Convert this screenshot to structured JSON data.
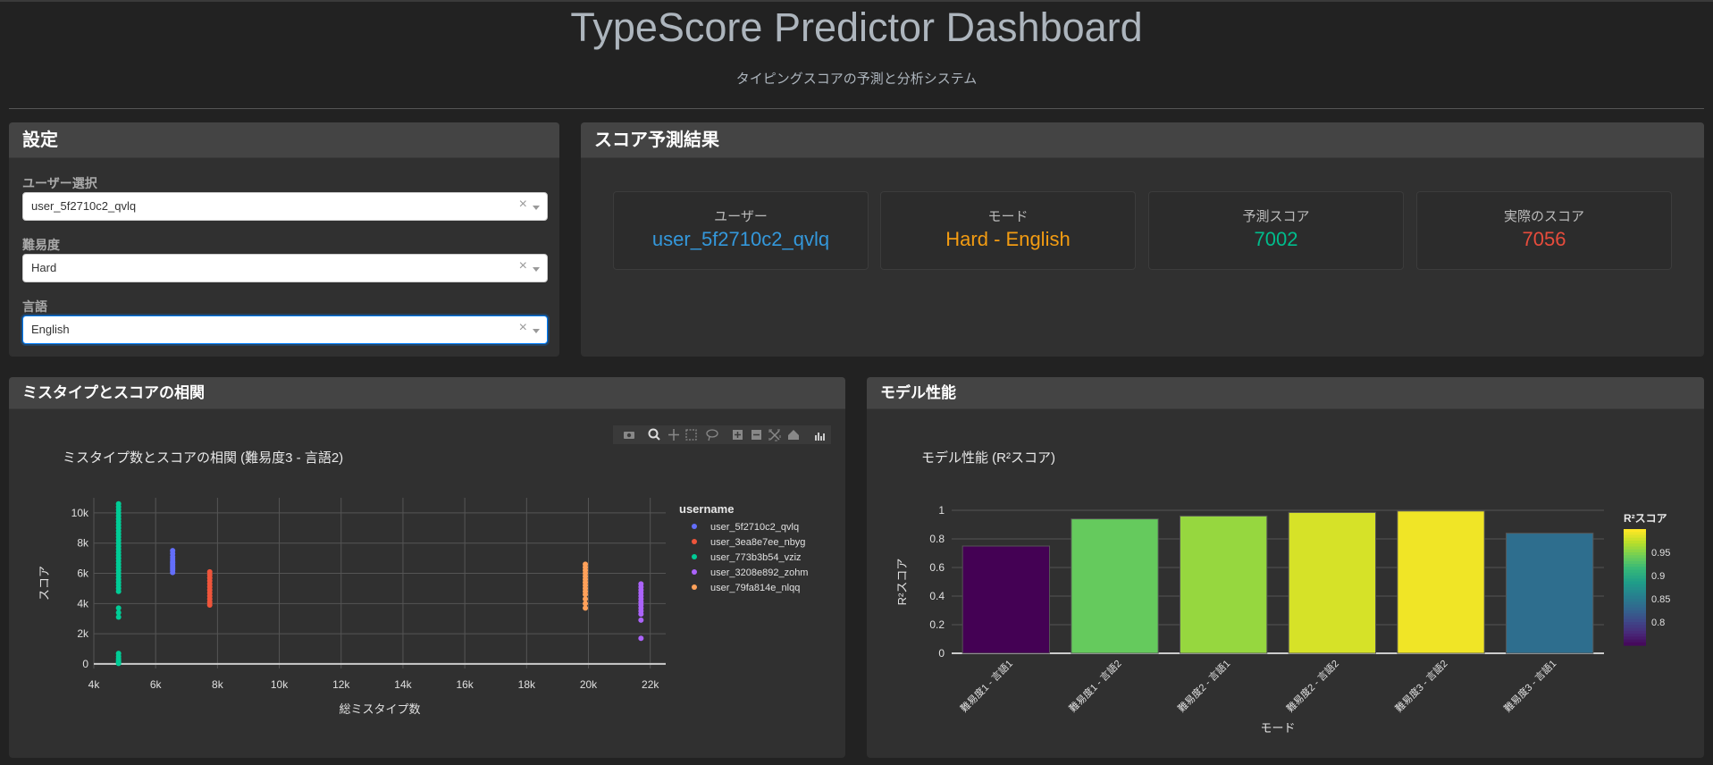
{
  "header": {
    "title": "TypeScore Predictor Dashboard",
    "subtitle": "タイピングスコアの予測と分析システム"
  },
  "settings": {
    "title": "設定",
    "user_label": "ユーザー選択",
    "user_value": "user_5f2710c2_qvlq",
    "difficulty_label": "難易度",
    "difficulty_value": "Hard",
    "language_label": "言語",
    "language_value": "English",
    "clear_symbol": "×"
  },
  "prediction": {
    "title": "スコア予測結果",
    "user_label": "ユーザー",
    "user_value": "user_5f2710c2_qvlq",
    "mode_label": "モード",
    "mode_value": "Hard - English",
    "predicted_label": "予測スコア",
    "predicted_value": "7002",
    "actual_label": "実際のスコア",
    "actual_value": "7056",
    "colors": {
      "user": "#3498db",
      "mode": "#f39c12",
      "predicted": "#00bc8c",
      "actual": "#e74c3c"
    }
  },
  "scatter_card": {
    "title": "ミスタイプとスコアの相関"
  },
  "bar_card": {
    "title": "モデル性能"
  },
  "chart_data": [
    {
      "type": "scatter",
      "title": "ミスタイプ数とスコアの相関 (難易度3 - 言語2)",
      "xlabel": "総ミスタイプ数",
      "ylabel": "スコア",
      "xlim": [
        4000,
        22500
      ],
      "ylim": [
        -300,
        11000
      ],
      "xticks": [
        4000,
        6000,
        8000,
        10000,
        12000,
        14000,
        16000,
        18000,
        20000,
        22000
      ],
      "xtick_labels": [
        "4k",
        "6k",
        "8k",
        "10k",
        "12k",
        "14k",
        "16k",
        "18k",
        "20k",
        "22k"
      ],
      "yticks": [
        0,
        2000,
        4000,
        6000,
        8000,
        10000
      ],
      "ytick_labels": [
        "0",
        "2k",
        "4k",
        "6k",
        "8k",
        "10k"
      ],
      "grid": true,
      "legend_title": "username",
      "legend_position": "right",
      "series": [
        {
          "name": "user_5f2710c2_qvlq",
          "color": "#636efa",
          "x": [
            6550,
            6550,
            6550,
            6550,
            6550,
            6550,
            6550,
            6550,
            6550,
            6550,
            6550,
            6550
          ],
          "y": [
            7500,
            7300,
            7100,
            6950,
            6800,
            6700,
            6600,
            6500,
            6400,
            6300,
            6200,
            6050
          ]
        },
        {
          "name": "user_3ea8e7ee_nbyg",
          "color": "#ef553b",
          "x": [
            7750,
            7750,
            7750,
            7750,
            7750,
            7750,
            7750,
            7750,
            7750,
            7750,
            7750,
            7750
          ],
          "y": [
            6100,
            5900,
            5700,
            5500,
            5300,
            5100,
            4900,
            4700,
            4500,
            4300,
            4100,
            3900
          ]
        },
        {
          "name": "user_773b3b54_vziz",
          "color": "#00cc96",
          "x": [
            4800,
            4800,
            4800,
            4800,
            4800,
            4800,
            4800,
            4800,
            4800,
            4800,
            4800,
            4800,
            4800,
            4800,
            4800,
            4800,
            4800,
            4800,
            4800,
            4800,
            4800,
            4800,
            4800,
            4800,
            4800,
            4800,
            4800,
            4800,
            4800,
            4800,
            4800,
            4800,
            4800,
            4800,
            4800,
            4800,
            4800,
            4800,
            4800,
            4800
          ],
          "y": [
            10600,
            10400,
            10200,
            10000,
            9800,
            9600,
            9400,
            9200,
            9000,
            8800,
            8600,
            8400,
            8200,
            8000,
            7800,
            7600,
            7400,
            7200,
            7000,
            6800,
            6600,
            6400,
            6200,
            6000,
            5800,
            5600,
            5400,
            5200,
            5000,
            4800,
            3700,
            3400,
            3100,
            700,
            500,
            350,
            250,
            150,
            80,
            30
          ]
        },
        {
          "name": "user_3208e892_zohm",
          "color": "#ab63fa",
          "x": [
            21700,
            21700,
            21700,
            21700,
            21700,
            21700,
            21700,
            21700,
            21700,
            21700,
            21700,
            21700,
            21700
          ],
          "y": [
            5300,
            5100,
            4900,
            4700,
            4500,
            4300,
            4100,
            3900,
            3700,
            3500,
            3300,
            2900,
            1700
          ]
        },
        {
          "name": "user_79fa814e_nlqq",
          "color": "#ffa15a",
          "x": [
            19900,
            19900,
            19900,
            19900,
            19900,
            19900,
            19900,
            19900,
            19900,
            19900,
            19900,
            19900,
            19900,
            19900
          ],
          "y": [
            6600,
            6400,
            6200,
            6000,
            5800,
            5600,
            5400,
            5200,
            5000,
            4800,
            4600,
            4300,
            4000,
            3700
          ]
        }
      ]
    },
    {
      "type": "bar",
      "title": "モデル性能 (R²スコア)",
      "xlabel": "モード",
      "ylabel": "R²スコア",
      "ylim": [
        0,
        1.0
      ],
      "yticks": [
        0,
        0.2,
        0.4,
        0.6,
        0.8,
        1
      ],
      "ytick_labels": [
        "0",
        "0.2",
        "0.4",
        "0.6",
        "0.8",
        "1"
      ],
      "categories": [
        "難易度1 - 言語1",
        "難易度1 - 言語2",
        "難易度2 - 言語1",
        "難易度2 - 言語2",
        "難易度3 - 言語2",
        "難易度3 - 言語1"
      ],
      "values": [
        0.75,
        0.94,
        0.96,
        0.985,
        0.995,
        0.84
      ],
      "colorscale": "viridis",
      "colorbar_title": "R²スコア",
      "colorbar_range": [
        0.75,
        1.0
      ],
      "colorbar_ticks": [
        0.8,
        0.85,
        0.9,
        0.95
      ],
      "colorbar_tick_labels": [
        "0.8",
        "0.85",
        "0.9",
        "0.95"
      ],
      "grid": true
    }
  ]
}
